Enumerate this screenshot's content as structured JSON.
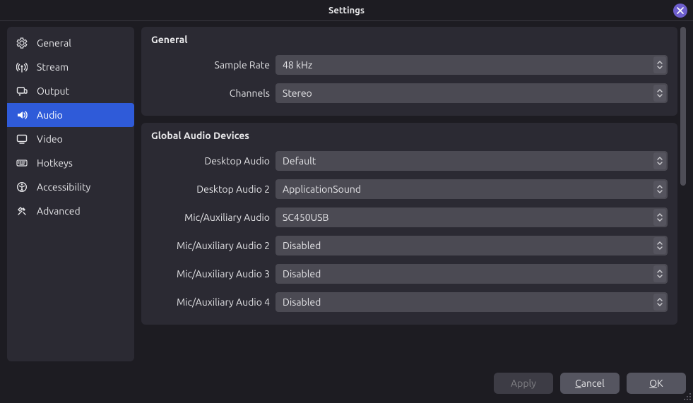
{
  "window": {
    "title": "Settings"
  },
  "sidebar": {
    "items": [
      {
        "icon": "gear",
        "label": "General"
      },
      {
        "icon": "antenna",
        "label": "Stream"
      },
      {
        "icon": "output",
        "label": "Output"
      },
      {
        "icon": "speaker",
        "label": "Audio",
        "active": true
      },
      {
        "icon": "monitor",
        "label": "Video"
      },
      {
        "icon": "keyboard",
        "label": "Hotkeys"
      },
      {
        "icon": "accessibility",
        "label": "Accessibility"
      },
      {
        "icon": "tools",
        "label": "Advanced"
      }
    ]
  },
  "sections": {
    "general": {
      "title": "General",
      "sample_rate": {
        "label": "Sample Rate",
        "value": "48 kHz"
      },
      "channels": {
        "label": "Channels",
        "value": "Stereo"
      }
    },
    "devices": {
      "title": "Global Audio Devices",
      "desktop_audio": {
        "label": "Desktop Audio",
        "value": "Default"
      },
      "desktop_audio_2": {
        "label": "Desktop Audio 2",
        "value": "ApplicationSound"
      },
      "mic_aux": {
        "label": "Mic/Auxiliary Audio",
        "value": "SC450USB"
      },
      "mic_aux_2": {
        "label": "Mic/Auxiliary Audio 2",
        "value": "Disabled"
      },
      "mic_aux_3": {
        "label": "Mic/Auxiliary Audio 3",
        "value": "Disabled"
      },
      "mic_aux_4": {
        "label": "Mic/Auxiliary Audio 4",
        "value": "Disabled"
      }
    }
  },
  "footer": {
    "apply": "Apply",
    "cancel_pre": "",
    "cancel_u": "C",
    "cancel_post": "ancel",
    "ok_pre": "",
    "ok_u": "O",
    "ok_post": "K"
  }
}
